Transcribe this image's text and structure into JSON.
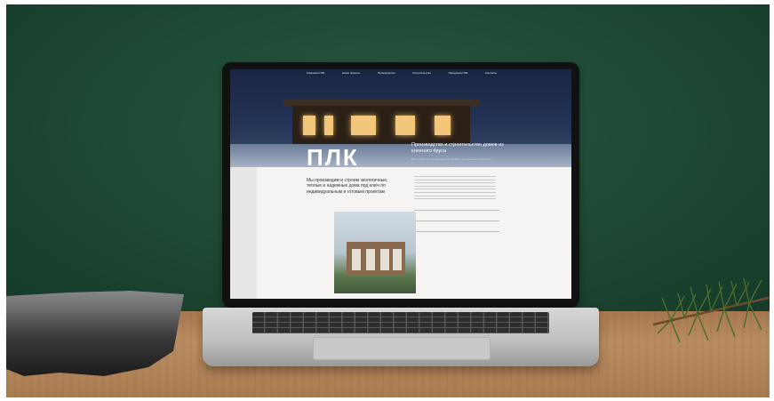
{
  "site": {
    "nav": [
      "Компания ПЛК",
      "Наши проекты",
      "Производство",
      "Строительство",
      "Продукция ПЛК",
      "Контакты"
    ],
    "logo": "ПЛК",
    "hero_title": "Производство и строительство домов из клееного бруса",
    "hero_subtitle": "Экологичность и натуральные материалы, долговечность и комфорт",
    "tagline": "Мы производим и строим экологичные, теплые и надежные дома под ключ по индивидуальным и готовым проектам"
  },
  "colors": {
    "wall": "#1f4a36",
    "table": "#b98c60",
    "hero_night": "#1a2540",
    "window_glow": "#f2c77b"
  },
  "icons": [
    "pine-branch-icon",
    "stone-slab-icon"
  ]
}
